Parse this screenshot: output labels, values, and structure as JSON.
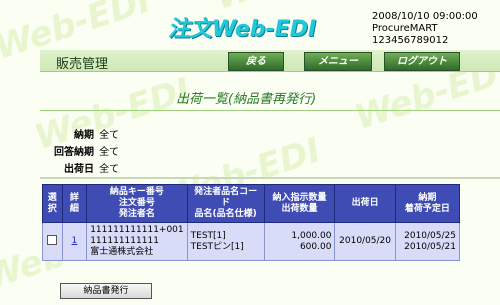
{
  "watermark": [
    "Web-EDI",
    "Web-EDI",
    "Web-EDI",
    "Web-EDI",
    "Web-EDI",
    "Web-EDI"
  ],
  "logo": "注文Web-EDI",
  "header_info": {
    "datetime": "2008/10/10 09:00:00",
    "company": "ProcureMART",
    "user_id": "123456789012"
  },
  "section_title": "販売管理",
  "nav": {
    "back": "戻る",
    "menu": "メニュー",
    "logout": "ログアウト"
  },
  "page_title": "出荷一覧(納品書再発行)",
  "filters": [
    {
      "label": "納期",
      "value": "全て"
    },
    {
      "label": "回答納期",
      "value": "全て"
    },
    {
      "label": "出荷日",
      "value": "全て"
    }
  ],
  "table": {
    "headers": {
      "select": "選択",
      "detail": "詳細",
      "keys": [
        "納品キー番号",
        "注文番号",
        "発注者名"
      ],
      "item": [
        "発注者品名コード",
        "品名(品名仕様)"
      ],
      "qty": [
        "納入指示数量",
        "出荷数量"
      ],
      "ship_date": "出荷日",
      "delivery": [
        "納期",
        "着荷予定日"
      ]
    },
    "rows": [
      {
        "detail_link": "1",
        "key_no": "111111111111+001",
        "order_no": "111111111111",
        "orderer": "富士通株式会社",
        "item_code": "TEST[1]",
        "item_name": "TESTピン[1]",
        "instr_qty": "1,000.00",
        "ship_qty": "600.00",
        "ship_date": "2010/05/20",
        "due_date": "2010/05/25",
        "arrival_date": "2010/05/21"
      }
    ]
  },
  "action_button": "納品書発行"
}
